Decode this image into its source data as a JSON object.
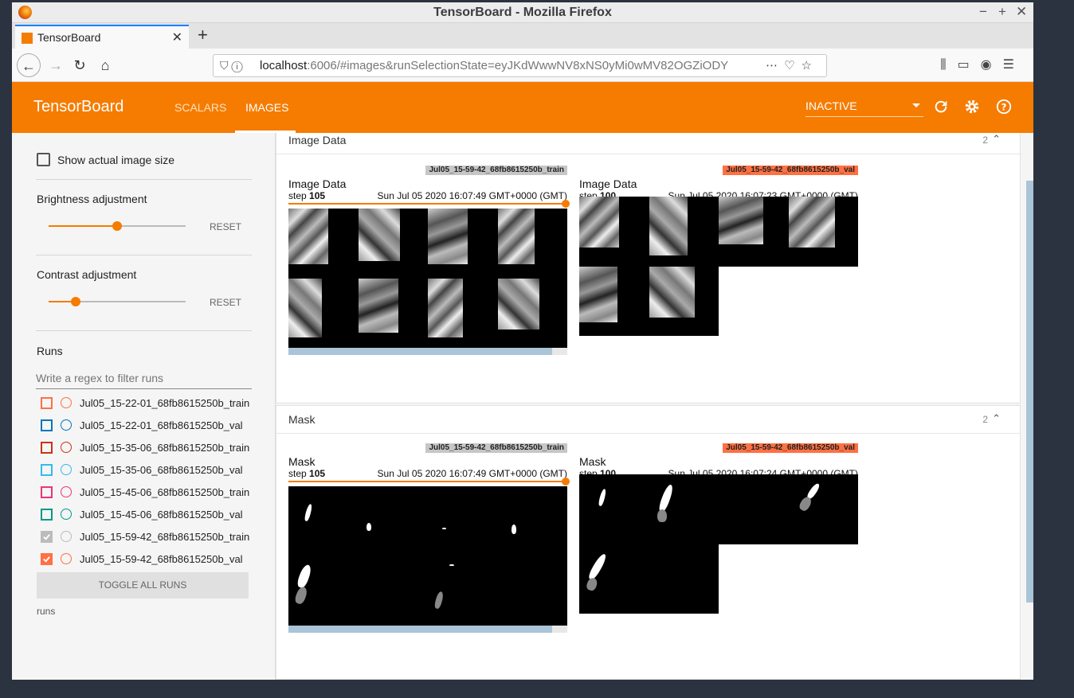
{
  "window": {
    "title": "TensorBoard - Mozilla Firefox"
  },
  "browser": {
    "tab_title": "TensorBoard",
    "url_host": "localhost",
    "url_rest": ":6006/#images&runSelectionState=eyJKdWwwNV8xNS0yMi0wMV82OGZiODY"
  },
  "header": {
    "brand": "TensorBoard",
    "tabs": [
      {
        "label": "SCALARS"
      },
      {
        "label": "IMAGES"
      }
    ],
    "status": "INACTIVE",
    "accent": "#f57c00"
  },
  "sidebar": {
    "show_actual_size": "Show actual image size",
    "brightness": {
      "label": "Brightness adjustment",
      "reset": "RESET",
      "value": 0.5
    },
    "contrast": {
      "label": "Contrast adjustment",
      "reset": "RESET",
      "value": 0.2
    },
    "runs_title": "Runs",
    "filter_placeholder": "Write a regex to filter runs",
    "runs": [
      {
        "name": "Jul05_15-22-01_68fb8615250b_train",
        "color": "#ff7043",
        "checked": false
      },
      {
        "name": "Jul05_15-22-01_68fb8615250b_val",
        "color": "#0077bb",
        "checked": false
      },
      {
        "name": "Jul05_15-35-06_68fb8615250b_train",
        "color": "#cc3311",
        "checked": false
      },
      {
        "name": "Jul05_15-35-06_68fb8615250b_val",
        "color": "#33bbee",
        "checked": false
      },
      {
        "name": "Jul05_15-45-06_68fb8615250b_train",
        "color": "#ee3377",
        "checked": false
      },
      {
        "name": "Jul05_15-45-06_68fb8615250b_val",
        "color": "#009988",
        "checked": false
      },
      {
        "name": "Jul05_15-59-42_68fb8615250b_train",
        "color": "#bbbbbb",
        "checked": true
      },
      {
        "name": "Jul05_15-59-42_68fb8615250b_val",
        "color": "#ff7043",
        "checked": true
      }
    ],
    "toggle_all": "TOGGLE ALL RUNS",
    "footer": "runs"
  },
  "cards": [
    {
      "title": "Image Data",
      "count": "2",
      "panes": [
        {
          "title": "Image Data",
          "step_label": "step",
          "step": "105",
          "date": "Sun Jul 05 2020 16:07:49 GMT+0000 (GMT)",
          "run": "Jul05_15-59-42_68fb8615250b_train"
        },
        {
          "title": "Image Data",
          "step_label": "step",
          "step": "100",
          "date": "Sun Jul 05 2020 16:07:23 GMT+0000 (GMT)",
          "run": "Jul05_15-59-42_68fb8615250b_val"
        }
      ]
    },
    {
      "title": "Mask",
      "count": "2",
      "panes": [
        {
          "title": "Mask",
          "step_label": "step",
          "step": "105",
          "date": "Sun Jul 05 2020 16:07:49 GMT+0000 (GMT)",
          "run": "Jul05_15-59-42_68fb8615250b_train"
        },
        {
          "title": "Mask",
          "step_label": "step",
          "step": "100",
          "date": "Sun Jul 05 2020 16:07:24 GMT+0000 (GMT)",
          "run": "Jul05_15-59-42_68fb8615250b_val"
        }
      ]
    }
  ]
}
